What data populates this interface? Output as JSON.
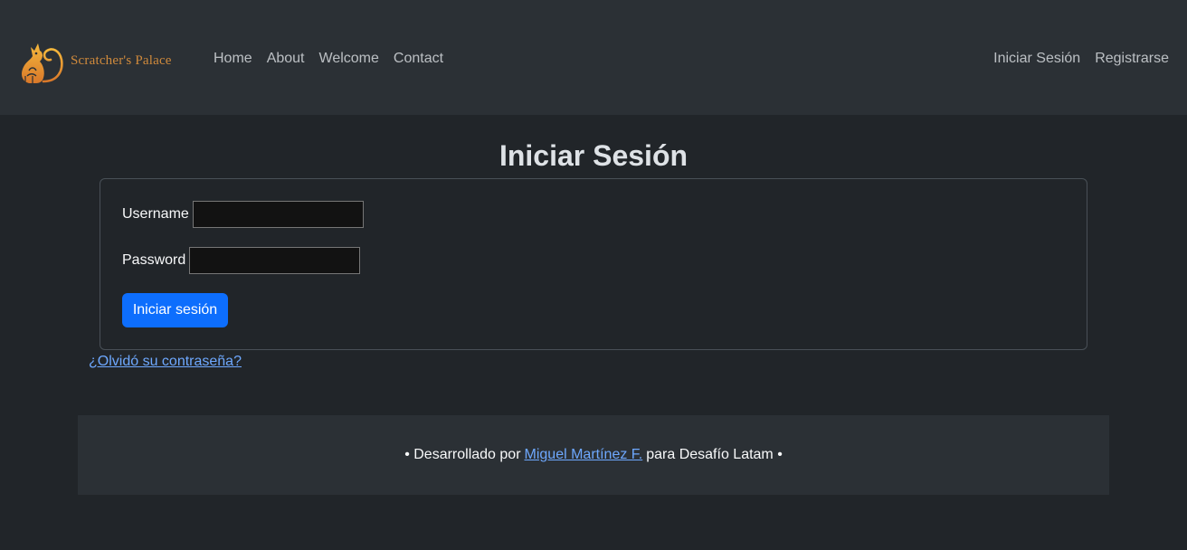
{
  "navbar": {
    "brand": {
      "logo_icon": "cat-logo-icon",
      "name": "Scratcher's Palace",
      "color": "#d08a3c"
    },
    "left_links": [
      "Home",
      "About",
      "Welcome",
      "Contact"
    ],
    "right_links": [
      "Iniciar Sesión",
      "Registrarse"
    ]
  },
  "page": {
    "title": "Iniciar Sesión"
  },
  "form": {
    "username_label": "Username",
    "username_value": "",
    "password_label": "Password",
    "password_value": "",
    "submit_label": "Iniciar sesión",
    "submit_color": "#0d6efd"
  },
  "forgot_link": "¿Olvidó su contraseña?",
  "footer": {
    "prefix": "• Desarrollado por",
    "author_link": "Miguel Martínez F.",
    "suffix": "para Desafío Latam •"
  },
  "colors": {
    "background": "#212529",
    "navbar": "#2b3035",
    "link": "#6ea8fe"
  }
}
